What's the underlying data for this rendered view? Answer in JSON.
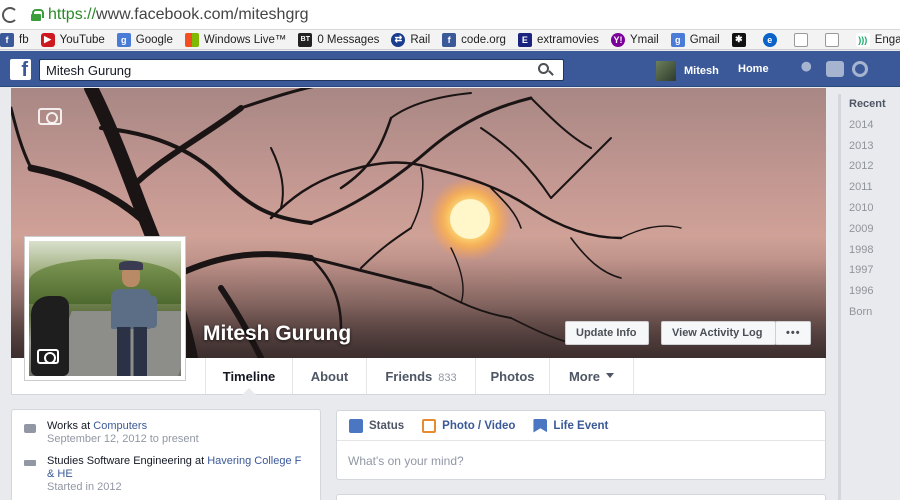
{
  "browser": {
    "url_scheme": "https://",
    "url_rest": "www.facebook.com/miteshgrg"
  },
  "bookmarks": [
    {
      "label": "fb",
      "icon": "facebook-icon"
    },
    {
      "label": "YouTube",
      "icon": "youtube-icon"
    },
    {
      "label": "Google",
      "icon": "google-icon"
    },
    {
      "label": "Windows Live™",
      "icon": "windows-icon"
    },
    {
      "label": "0 Messages",
      "icon": "bt-icon"
    },
    {
      "label": "Rail",
      "icon": "rail-icon"
    },
    {
      "label": "code.org",
      "icon": "facebook-icon"
    },
    {
      "label": "extramovies",
      "icon": "e-icon"
    },
    {
      "label": "Ymail",
      "icon": "yahoo-icon"
    },
    {
      "label": "Gmail",
      "icon": "google-icon"
    },
    {
      "label": "",
      "icon": "star-icon"
    },
    {
      "label": "",
      "icon": "edge-icon"
    },
    {
      "label": "",
      "icon": "document-icon"
    },
    {
      "label": "",
      "icon": "document-icon"
    },
    {
      "label": "Engadget",
      "icon": "rss-icon"
    }
  ],
  "header": {
    "search_value": "Mitesh Gurung",
    "user_name": "Mitesh",
    "home_label": "Home",
    "brand_color": "#3b5998"
  },
  "profile": {
    "name": "Mitesh Gurung",
    "update_info": "Update Info",
    "view_activity_log": "View Activity Log",
    "more_dots": "•••"
  },
  "tabs": {
    "timeline": "Timeline",
    "about": "About",
    "friends": "Friends",
    "friends_count": "833",
    "photos": "Photos",
    "more": "More"
  },
  "years": [
    "Recent",
    "2014",
    "2013",
    "2012",
    "2011",
    "2010",
    "2009",
    "1998",
    "1997",
    "1996",
    "Born"
  ],
  "about": {
    "work_prefix": "Works at ",
    "work_link": "Computers",
    "work_date": "September 12, 2012 to present",
    "study_prefix": "Studies Software Engineering at ",
    "study_link": "Havering College F & HE",
    "study_date": "Started in 2012"
  },
  "composer": {
    "status": "Status",
    "photo_video": "Photo / Video",
    "life_event": "Life Event",
    "placeholder": "What's on your mind?"
  }
}
